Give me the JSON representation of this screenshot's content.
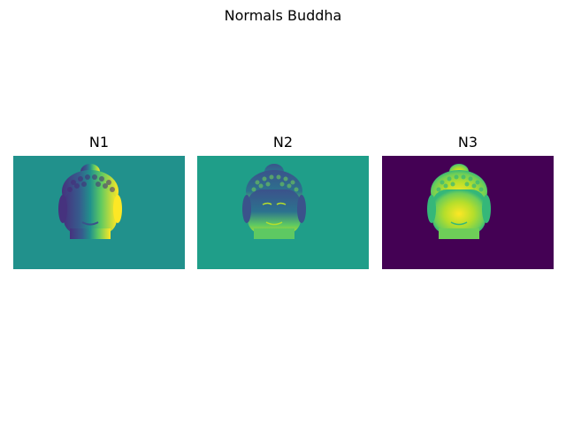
{
  "figure": {
    "title": "Normals Buddha"
  },
  "panels": [
    {
      "title": "N1",
      "background_color": "#21918c",
      "head_colors": [
        "#3b0f70",
        "#31688e",
        "#35b779",
        "#fde725"
      ],
      "colormap": "viridis"
    },
    {
      "title": "N2",
      "background_color": "#1f9e89",
      "head_colors": [
        "#2c728e",
        "#3b528b",
        "#5ec962",
        "#b5de2b"
      ],
      "colormap": "viridis"
    },
    {
      "title": "N3",
      "background_color": "#440154",
      "head_colors": [
        "#35b779",
        "#6ece58",
        "#b5de2b",
        "#fde725"
      ],
      "colormap": "viridis"
    }
  ]
}
